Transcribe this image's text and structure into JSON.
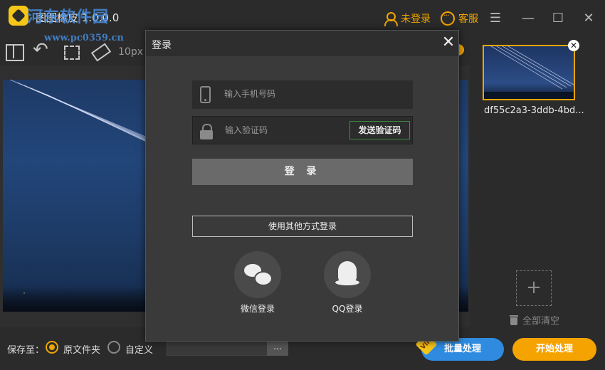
{
  "app": {
    "title": "图图橡皮 1.0.0.0",
    "watermark": "河东软件园",
    "watermark_url": "www.pc0359.cn",
    "user_label": "未登录",
    "service_label": "客服",
    "menu_glyph": "☰",
    "minimize_glyph": "—",
    "maximize_glyph": "☐",
    "close_glyph": "✕"
  },
  "toolbar": {
    "brush_size": "10px",
    "undo_glyph": "↶"
  },
  "thumbnails": {
    "items": [
      {
        "name": "df55c2a3-3ddb-4bd...",
        "selected": true
      }
    ],
    "close_glyph": "✕",
    "add_glyph": "+",
    "clear_all_label": "全部清空"
  },
  "bottom": {
    "save_to_label": "保存至：",
    "option_original": "原文件夹",
    "option_custom": "自定义",
    "selected_option": "原文件夹",
    "path_value": "",
    "browse_label": "...",
    "vip_badge": "VIP",
    "batch_label": "批量处理",
    "start_label": "开始处理"
  },
  "login_dialog": {
    "title": "登录",
    "close_glyph": "✕",
    "phone_placeholder": "输入手机号码",
    "code_placeholder": "输入验证码",
    "send_code_label": "发送验证码",
    "login_label": "登 录",
    "other_login_label": "使用其他方式登录",
    "wechat_label": "微信登录",
    "qq_label": "QQ登录"
  },
  "colors": {
    "accent": "#f0a500",
    "batch_button": "#2e8be0",
    "start_button": "#f5a300",
    "background": "#2b2b2b",
    "dialog_background": "#3a3a3a"
  }
}
